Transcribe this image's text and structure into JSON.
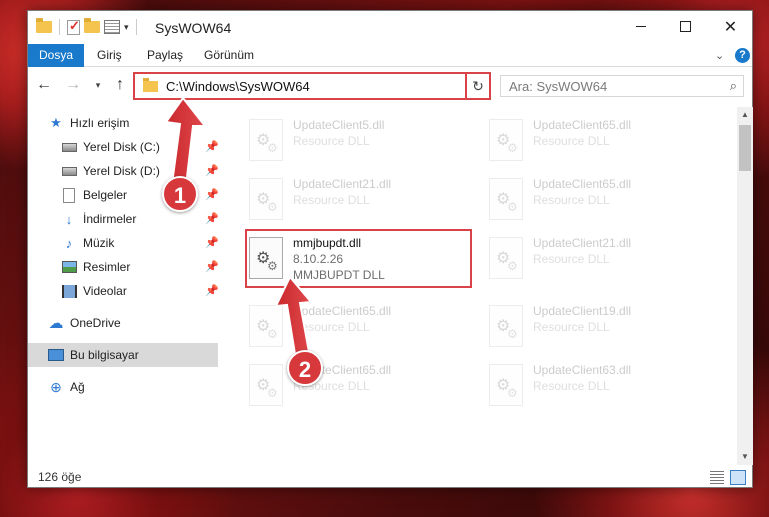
{
  "window": {
    "title": "SysWOW64"
  },
  "ribbon": {
    "tabs": [
      "Dosya",
      "Giriş",
      "Paylaş",
      "Görünüm"
    ],
    "help": "?"
  },
  "nav": {
    "address": "C:\\Windows\\SysWOW64",
    "search_placeholder": "Ara: SysWOW64"
  },
  "sidebar": {
    "quick_access": "Hızlı erişim",
    "items": [
      {
        "label": "Yerel Disk (C:)",
        "icon": "drive-icon",
        "pinned": true
      },
      {
        "label": "Yerel Disk (D:)",
        "icon": "drive-icon",
        "pinned": true
      },
      {
        "label": "Belgeler",
        "icon": "documents-icon",
        "pinned": true
      },
      {
        "label": "İndirmeler",
        "icon": "downloads-icon",
        "pinned": true
      },
      {
        "label": "Müzik",
        "icon": "music-icon",
        "pinned": true
      },
      {
        "label": "Resimler",
        "icon": "pictures-icon",
        "pinned": true
      },
      {
        "label": "Videolar",
        "icon": "videos-icon",
        "pinned": true
      }
    ],
    "onedrive": "OneDrive",
    "this_pc": "Bu bilgisayar",
    "network": "Ağ"
  },
  "files": [
    {
      "name": "UpdateClient5.dll",
      "type": "Resource DLL",
      "faded": true
    },
    {
      "name": "UpdateClient65.dll",
      "type": "Resource DLL",
      "faded": true
    },
    {
      "name": "UpdateClient21.dll",
      "type": "Resource DLL",
      "faded": true
    },
    {
      "name": "UpdateClient65.dll",
      "type": "Resource DLL",
      "faded": true
    },
    {
      "name": "mmjbupdt.dll",
      "version": "8.10.2.26",
      "type": "MMJBUPDT DLL",
      "faded": false
    },
    {
      "name": "UpdateClient21.dll",
      "type": "Resource DLL",
      "faded": true
    },
    {
      "name": "UpdateClient65.dll",
      "type": "Resource DLL",
      "faded": true
    },
    {
      "name": "UpdateClient19.dll",
      "type": "Resource DLL",
      "faded": true
    },
    {
      "name": "UpdateClient65.dll",
      "type": "Resource DLL",
      "faded": true
    },
    {
      "name": "UpdateClient63.dll",
      "type": "Resource DLL",
      "faded": true
    }
  ],
  "status": {
    "count": "126 öğe"
  },
  "steps": [
    "1",
    "2"
  ],
  "colors": {
    "accent": "#1979ca",
    "highlight": "#d94348",
    "step": "#d6383b"
  }
}
